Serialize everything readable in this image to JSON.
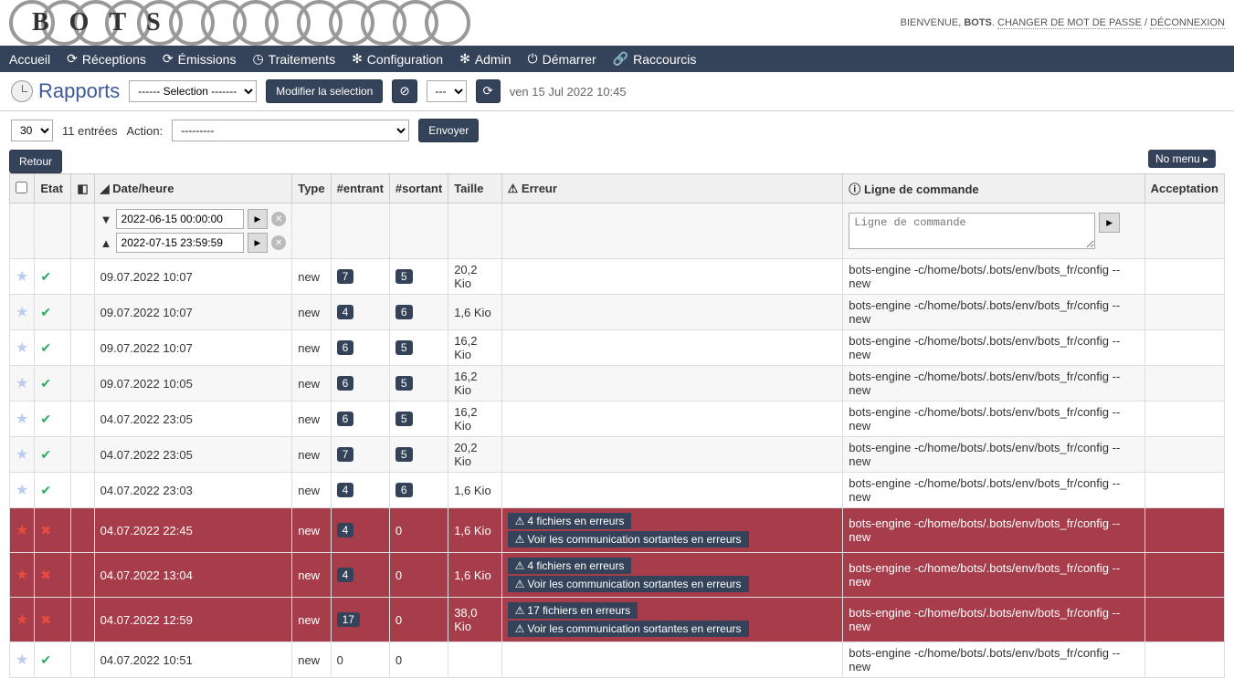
{
  "header": {
    "logo": "BOTS",
    "welcome": "BIENVENUE,",
    "username": "BOTS",
    "change_password": "CHANGER DE MOT DE PASSE",
    "logout": "DÉCONNEXION"
  },
  "nav": {
    "home": "Accueil",
    "receptions": "Réceptions",
    "emissions": "Émissions",
    "treatments": "Traitements",
    "configuration": "Configuration",
    "admin": "Admin",
    "start": "Démarrer",
    "shortcuts": "Raccourcis"
  },
  "page": {
    "title": "Rapports",
    "selection_placeholder": "------ Selection -------",
    "modify_selection": "Modifier la selection",
    "dropdown2": "---",
    "timestamp": "ven 15 Jul 2022  10:45"
  },
  "toolbar": {
    "per_page": "30",
    "entries_label": "11 entrées",
    "action_label": "Action:",
    "action_placeholder": "---------",
    "send": "Envoyer",
    "back": "Retour",
    "no_menu": "No menu"
  },
  "columns": {
    "etat": "Etat",
    "datetime": "Date/heure",
    "type": "Type",
    "entrant": "#entrant",
    "sortant": "#sortant",
    "taille": "Taille",
    "erreur": "Erreur",
    "commande": "Ligne de commande",
    "acceptation": "Acceptation"
  },
  "filters": {
    "date_from": "2022-06-15 00:00:00",
    "date_to": "2022-07-15 23:59:59",
    "cmd_placeholder": "Ligne de commande"
  },
  "rows": [
    {
      "star": false,
      "status": "ok",
      "datetime": "09.07.2022  10:07",
      "type": "new",
      "entrant": "7",
      "sortant": "5",
      "taille": "20,2 Kio",
      "errors": [],
      "cmd": "bots-engine -c/home/bots/.bots/env/bots_fr/config --new"
    },
    {
      "star": false,
      "status": "ok",
      "datetime": "09.07.2022  10:07",
      "type": "new",
      "entrant": "4",
      "sortant": "6",
      "taille": "1,6 Kio",
      "errors": [],
      "cmd": "bots-engine -c/home/bots/.bots/env/bots_fr/config --new"
    },
    {
      "star": false,
      "status": "ok",
      "datetime": "09.07.2022  10:07",
      "type": "new",
      "entrant": "6",
      "sortant": "5",
      "taille": "16,2 Kio",
      "errors": [],
      "cmd": "bots-engine -c/home/bots/.bots/env/bots_fr/config --new"
    },
    {
      "star": false,
      "status": "ok",
      "datetime": "09.07.2022  10:05",
      "type": "new",
      "entrant": "6",
      "sortant": "5",
      "taille": "16,2 Kio",
      "errors": [],
      "cmd": "bots-engine -c/home/bots/.bots/env/bots_fr/config --new"
    },
    {
      "star": false,
      "status": "ok",
      "datetime": "04.07.2022  23:05",
      "type": "new",
      "entrant": "6",
      "sortant": "5",
      "taille": "16,2 Kio",
      "errors": [],
      "cmd": "bots-engine -c/home/bots/.bots/env/bots_fr/config --new"
    },
    {
      "star": false,
      "status": "ok",
      "datetime": "04.07.2022  23:05",
      "type": "new",
      "entrant": "7",
      "sortant": "5",
      "taille": "20,2 Kio",
      "errors": [],
      "cmd": "bots-engine -c/home/bots/.bots/env/bots_fr/config --new"
    },
    {
      "star": false,
      "status": "ok",
      "datetime": "04.07.2022  23:03",
      "type": "new",
      "entrant": "4",
      "sortant": "6",
      "taille": "1,6 Kio",
      "errors": [],
      "cmd": "bots-engine -c/home/bots/.bots/env/bots_fr/config --new"
    },
    {
      "star": true,
      "status": "err",
      "datetime": "04.07.2022  22:45",
      "type": "new",
      "entrant": "4",
      "sortant_raw": "0",
      "taille": "1,6 Kio",
      "errors": [
        "4 fichiers en erreurs",
        "Voir les communication sortantes en erreurs"
      ],
      "cmd": "bots-engine -c/home/bots/.bots/env/bots_fr/config --new"
    },
    {
      "star": true,
      "status": "err",
      "datetime": "04.07.2022  13:04",
      "type": "new",
      "entrant": "4",
      "sortant_raw": "0",
      "taille": "1,6 Kio",
      "errors": [
        "4 fichiers en erreurs",
        "Voir les communication sortantes en erreurs"
      ],
      "cmd": "bots-engine -c/home/bots/.bots/env/bots_fr/config --new"
    },
    {
      "star": true,
      "status": "err",
      "datetime": "04.07.2022  12:59",
      "type": "new",
      "entrant": "17",
      "sortant_raw": "0",
      "taille": "38,0 Kio",
      "errors": [
        "17 fichiers en erreurs",
        "Voir les communication sortantes en erreurs"
      ],
      "cmd": "bots-engine -c/home/bots/.bots/env/bots_fr/config --new"
    },
    {
      "star": false,
      "status": "ok",
      "datetime": "04.07.2022  10:51",
      "type": "new",
      "entrant_raw": "0",
      "sortant_raw": "0",
      "taille": "",
      "errors": [],
      "cmd": "bots-engine -c/home/bots/.bots/env/bots_fr/config --new"
    }
  ]
}
